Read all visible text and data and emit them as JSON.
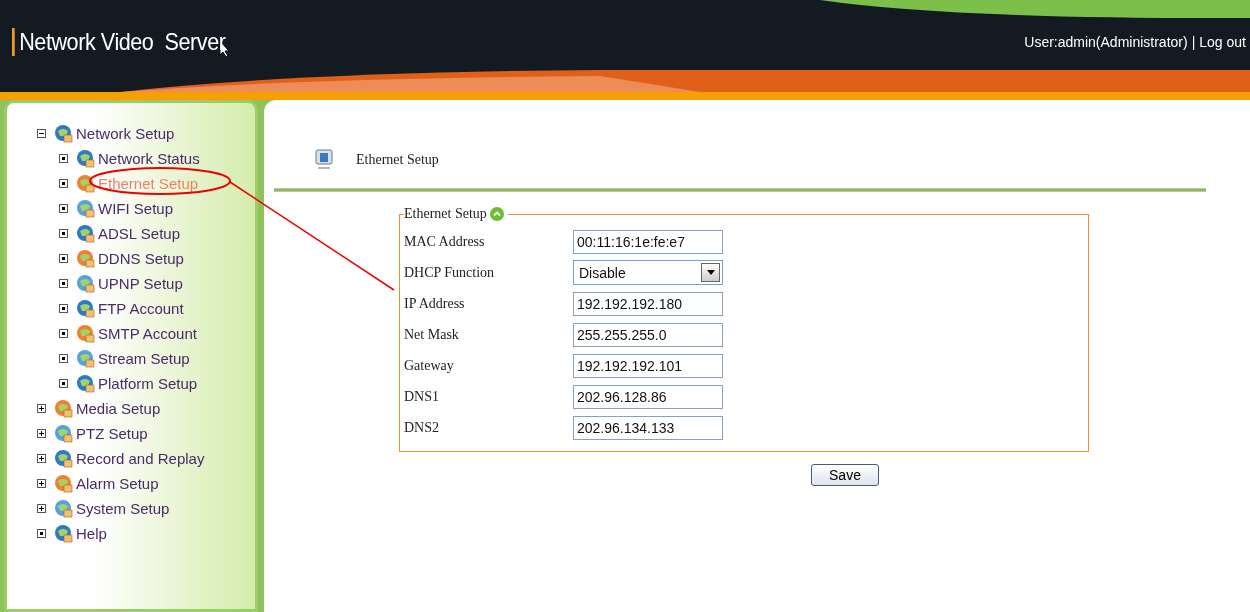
{
  "header": {
    "title": "Network Video  Server",
    "user": "User:admin(Administrator)",
    "separator": "|",
    "logout": "Log out"
  },
  "sidebar": {
    "items": [
      {
        "label": "Network Setup",
        "expanded": true,
        "selected": false,
        "children": [
          {
            "label": "Network Status",
            "selected": false
          },
          {
            "label": "Ethernet Setup",
            "selected": true
          },
          {
            "label": "WIFI Setup",
            "selected": false
          },
          {
            "label": "ADSL Setup",
            "selected": false
          },
          {
            "label": "DDNS Setup",
            "selected": false
          },
          {
            "label": "UPNP Setup",
            "selected": false
          },
          {
            "label": "FTP Account",
            "selected": false
          },
          {
            "label": "SMTP Account",
            "selected": false
          },
          {
            "label": "Stream Setup",
            "selected": false
          },
          {
            "label": "Platform Setup",
            "selected": false
          }
        ]
      },
      {
        "label": "Media Setup",
        "expanded": false,
        "selected": false
      },
      {
        "label": "PTZ Setup",
        "expanded": false,
        "selected": false
      },
      {
        "label": "Record and Replay",
        "expanded": false,
        "selected": false
      },
      {
        "label": "Alarm Setup",
        "expanded": false,
        "selected": false
      },
      {
        "label": "System Setup",
        "expanded": false,
        "selected": false
      },
      {
        "label": "Help",
        "selected": false
      }
    ]
  },
  "page": {
    "title": "Ethernet Setup"
  },
  "form": {
    "legend": "Ethernet Setup",
    "fields": [
      {
        "kind": "text",
        "label": "MAC Address",
        "value": "00:11:16:1e:fe:e7"
      },
      {
        "kind": "select",
        "label": "DHCP Function",
        "value": "Disable"
      },
      {
        "kind": "text",
        "label": "IP Address",
        "value": "192.192.192.180"
      },
      {
        "kind": "text",
        "label": "Net Mask",
        "value": "255.255.255.0"
      },
      {
        "kind": "text",
        "label": "Gateway",
        "value": "192.192.192.101"
      },
      {
        "kind": "text",
        "label": "DNS1",
        "value": "202.96.128.86"
      },
      {
        "kind": "text",
        "label": "DNS2",
        "value": "202.96.134.133"
      }
    ],
    "save": "Save"
  }
}
